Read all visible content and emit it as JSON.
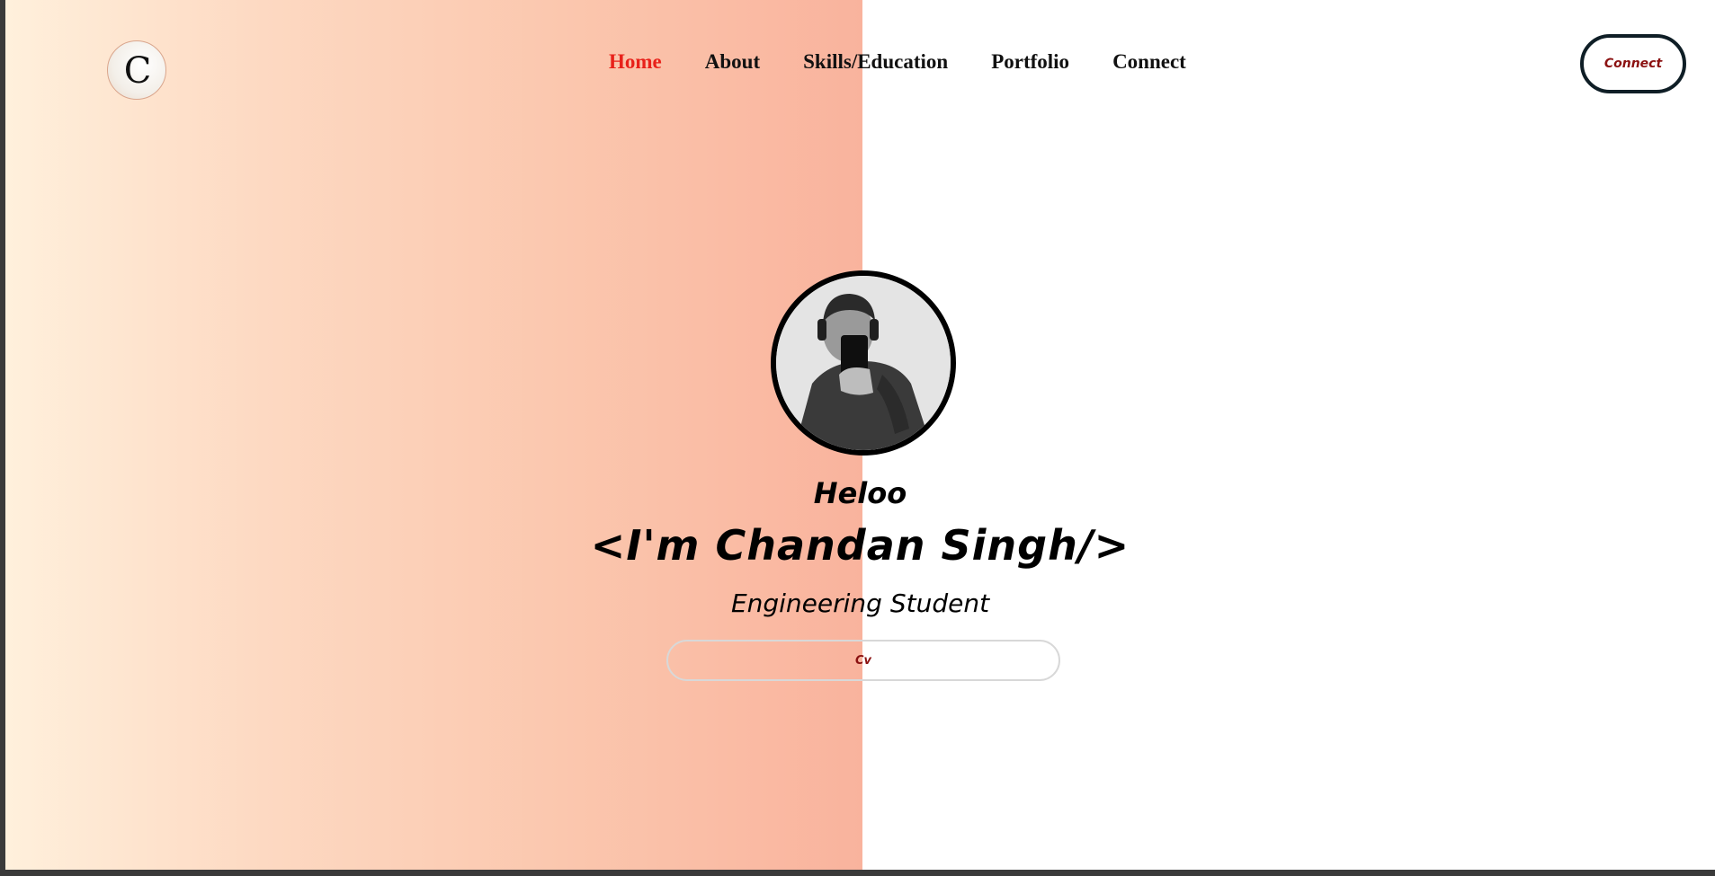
{
  "logo": {
    "letter": "C"
  },
  "nav": {
    "items": [
      {
        "label": "Home",
        "active": true
      },
      {
        "label": "About"
      },
      {
        "label": "Skills/Education"
      },
      {
        "label": "Portfolio"
      },
      {
        "label": "Connect"
      }
    ]
  },
  "header": {
    "connect_label": "Connect"
  },
  "hero": {
    "greeting": "Heloo",
    "name": "<I'm Chandan Singh/>",
    "role": "Engineering Student",
    "cv_label": "Cv"
  },
  "colors": {
    "active_nav": "#e8211a",
    "button_text": "#8b1111",
    "gradient_start": "#fff0dc",
    "gradient_end": "#f9b39d"
  }
}
